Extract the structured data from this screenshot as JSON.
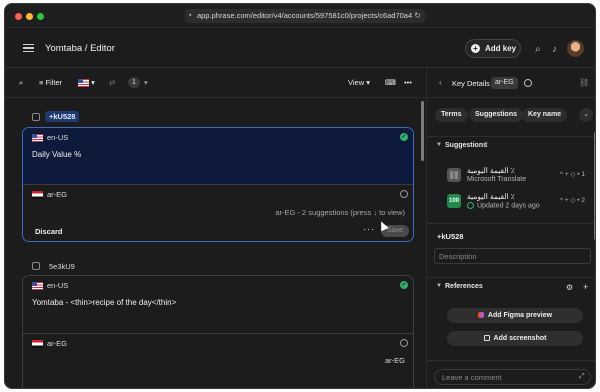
{
  "browser": {
    "url": "app.phrase.com/editor/v4/accounts/597581c0/projects/c6ad70a4"
  },
  "header": {
    "breadcrumb": "Yomtaba / Editor",
    "add_key_label": "Add key"
  },
  "toolbar": {
    "filter_label": "Filter",
    "view_label": "View",
    "count_badge": "1"
  },
  "keys": [
    {
      "key": "+kU528",
      "source_lang": "en-US",
      "source_text": "Daily Value %",
      "target_lang": "ar-EG",
      "hint": "ar-EG - 2 suggestions (press ↓ to view)",
      "discard_label": "Discard",
      "save_label": "Save"
    },
    {
      "key": "5e3kU9",
      "source_lang": "en-US",
      "source_text": "Yomtaba - <thin>recipe of the day</thin>",
      "target_lang": "ar-EG",
      "target_text": "ar-EG"
    }
  ],
  "panel": {
    "title": "Key Details",
    "lang_chip": "ar-EG",
    "tabs": [
      "Terms",
      "Suggestions",
      "Key name"
    ],
    "suggestions_label": "Suggestions",
    "suggestions_count": "2",
    "suggestions": [
      {
        "text": "القيمة اليومية ٪",
        "source": "Microsoft Translate",
        "votes": "^ + ◇ • 1"
      },
      {
        "text": "القيمة اليومية ٪",
        "source": "Updated 2 days ago",
        "badge": "100",
        "votes": "^ + ◇ • 2"
      }
    ],
    "key_name": "+kU528",
    "description_placeholder": "Description",
    "references_label": "References",
    "figma_label": "Add Figma preview",
    "screenshot_label": "Add screenshot",
    "comment_placeholder": "Leave a comment"
  },
  "colors": {
    "accent": "#3d6cc0",
    "success": "#2fb36b",
    "source_bg": "#0e1a3b"
  }
}
